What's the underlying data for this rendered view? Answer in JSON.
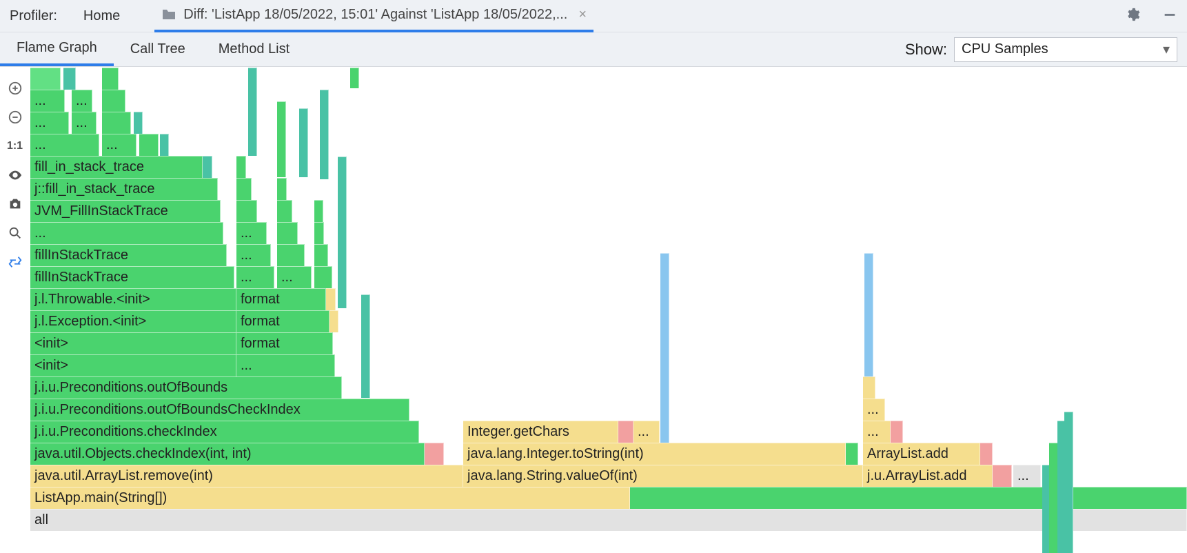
{
  "topbar": {
    "profiler_label": "Profiler:",
    "home": "Home",
    "diff_tab": "Diff: 'ListApp 18/05/2022, 15:01' Against 'ListApp 18/05/2022,..."
  },
  "subtabs": {
    "flame": "Flame Graph",
    "calltree": "Call Tree",
    "methodlist": "Method List"
  },
  "show": {
    "label": "Show:",
    "selected": "CPU Samples"
  },
  "flame": {
    "all": "all",
    "main": "ListApp.main(String[])",
    "row4_a": "java.util.ArrayList.remove(int)",
    "row4_b": "java.lang.String.valueOf(int)",
    "row4_c": "j.u.ArrayList.add",
    "row4_d": "...",
    "row5_a": "java.util.Objects.checkIndex(int, int)",
    "row5_b": "java.lang.Integer.toString(int)",
    "row5_c": "ArrayList.add",
    "row6_a": "j.i.u.Preconditions.checkIndex",
    "row6_b": "Integer.getChars",
    "row6_c": "...",
    "row6_d": "...",
    "row7_a": "j.i.u.Preconditions.outOfBoundsCheckIndex",
    "row7_b": "...",
    "row8_a": "j.i.u.Preconditions.outOfBounds",
    "row9_a": "<init>",
    "row9_b": "...",
    "row10_a": "<init>",
    "row10_b": "format",
    "row11_a": "j.l.Exception.<init>",
    "row11_b": "format",
    "row12_a": "j.l.Throwable.<init>",
    "row12_b": "format",
    "row13_a": "fillInStackTrace",
    "row13_b": "...",
    "row13_c": "...",
    "row14_a": "fillInStackTrace",
    "row14_b": "...",
    "row15_a": "...",
    "row15_b": "...",
    "row16_a": "JVM_FillInStackTrace",
    "row17_a": "j::fill_in_stack_trace",
    "row18_a": "fill_in_stack_trace",
    "row19_a": "...",
    "row19_b": "...",
    "row20_a": "...",
    "row20_b": "...",
    "row21_a": "...",
    "row21_b": "..."
  }
}
